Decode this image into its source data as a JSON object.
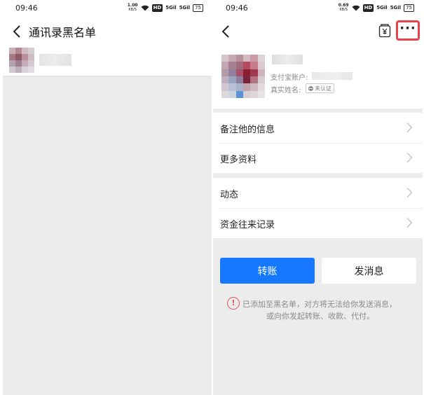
{
  "left_screen": {
    "status_bar": {
      "time": "09:46",
      "speed": "1.00",
      "speed_unit": "KB/S",
      "hd": "HD",
      "signal_1": "5Gil",
      "signal_2": "5Gil",
      "battery": "75"
    },
    "header": {
      "title": "通讯录黑名单"
    }
  },
  "right_screen": {
    "status_bar": {
      "time": "09:46",
      "speed": "0.69",
      "speed_unit": "KB/S",
      "hd": "HD",
      "signal_1": "5Gil",
      "signal_2": "5Gil",
      "battery": "75"
    },
    "profile": {
      "account_label": "支付宝账户:",
      "real_name_label": "真实姓名:",
      "verify_badge": "未认证"
    },
    "menu_groups": [
      [
        {
          "label": "备注他的信息"
        },
        {
          "label": "更多资料"
        }
      ],
      [
        {
          "label": "动态"
        },
        {
          "label": "资金往来记录"
        }
      ]
    ],
    "buttons": {
      "transfer": "转账",
      "message": "发消息"
    },
    "notice": {
      "icon_text": "!",
      "line1": "已添加至黑名单，对方将无法给你发送消息，",
      "line2": "或向你发起转账、收款、代付。"
    },
    "highlight_color": "#e8434c",
    "accent_color": "#1677ff"
  }
}
